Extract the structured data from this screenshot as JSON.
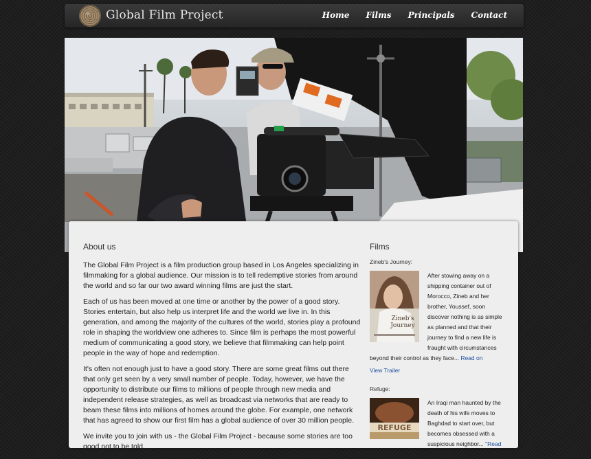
{
  "header": {
    "brand": "Global Film Project",
    "nav": [
      "Home",
      "Films",
      "Principals",
      "Contact"
    ]
  },
  "about": {
    "title": "About us",
    "paragraphs": [
      "The Global Film Project is a film production group based in Los Angeles specializing in filmmaking for a global audience. Our mission is to tell redemptive stories from around the world and so far our two award winning films are just the start.",
      "Each of us has been moved at one time or another by the power of a good story. Stories entertain, but also help us interpret life and the world we live in. In this generation, and among the majority of the cultures of the world, stories play a profound role in shaping the worldview one adheres to. Since film is perhaps the most powerful medium of communicating a good story, we believe that filmmaking can help point people in the way of hope and redemption.",
      "It's often not enough just to have a good story. There are some great films out there that only get seen by a very small number of people. Today, however, we have the opportunity to distribute our films to millions of people through new media and independent release strategies, as well as broadcast via networks that are ready to beam these films into millions of homes around the globe. For example, one network that has agreed to show our first film has a global audience of over 30 million people.",
      "We invite you to join with us - the Global Film Project - because some stories are too good not to be told."
    ]
  },
  "films": {
    "title": "Films",
    "items": [
      {
        "name": "Zineb's Journey:",
        "poster_text": "Zineb's Journey",
        "description": "After stowing away on a shipping container out of Morocco, Zineb and her brother, Youssef, soon discover nothing is as simple as planned and that their journey to find a new life is fraught with circumstances beyond their control as they face...",
        "link": "Read on",
        "trailer": "View Trailer"
      },
      {
        "name": "Refuge:",
        "poster_text": "REFUGE",
        "description": "An Iraqi man haunted by the death of his wife moves to Baghdad to start over, but becomes obsessed with a suspicious neighbor...",
        "link": "\"Read"
      }
    ]
  },
  "colors": {
    "link": "#1f4fa0",
    "card": "#eeeeee",
    "navbar": "#2f2f2f"
  }
}
